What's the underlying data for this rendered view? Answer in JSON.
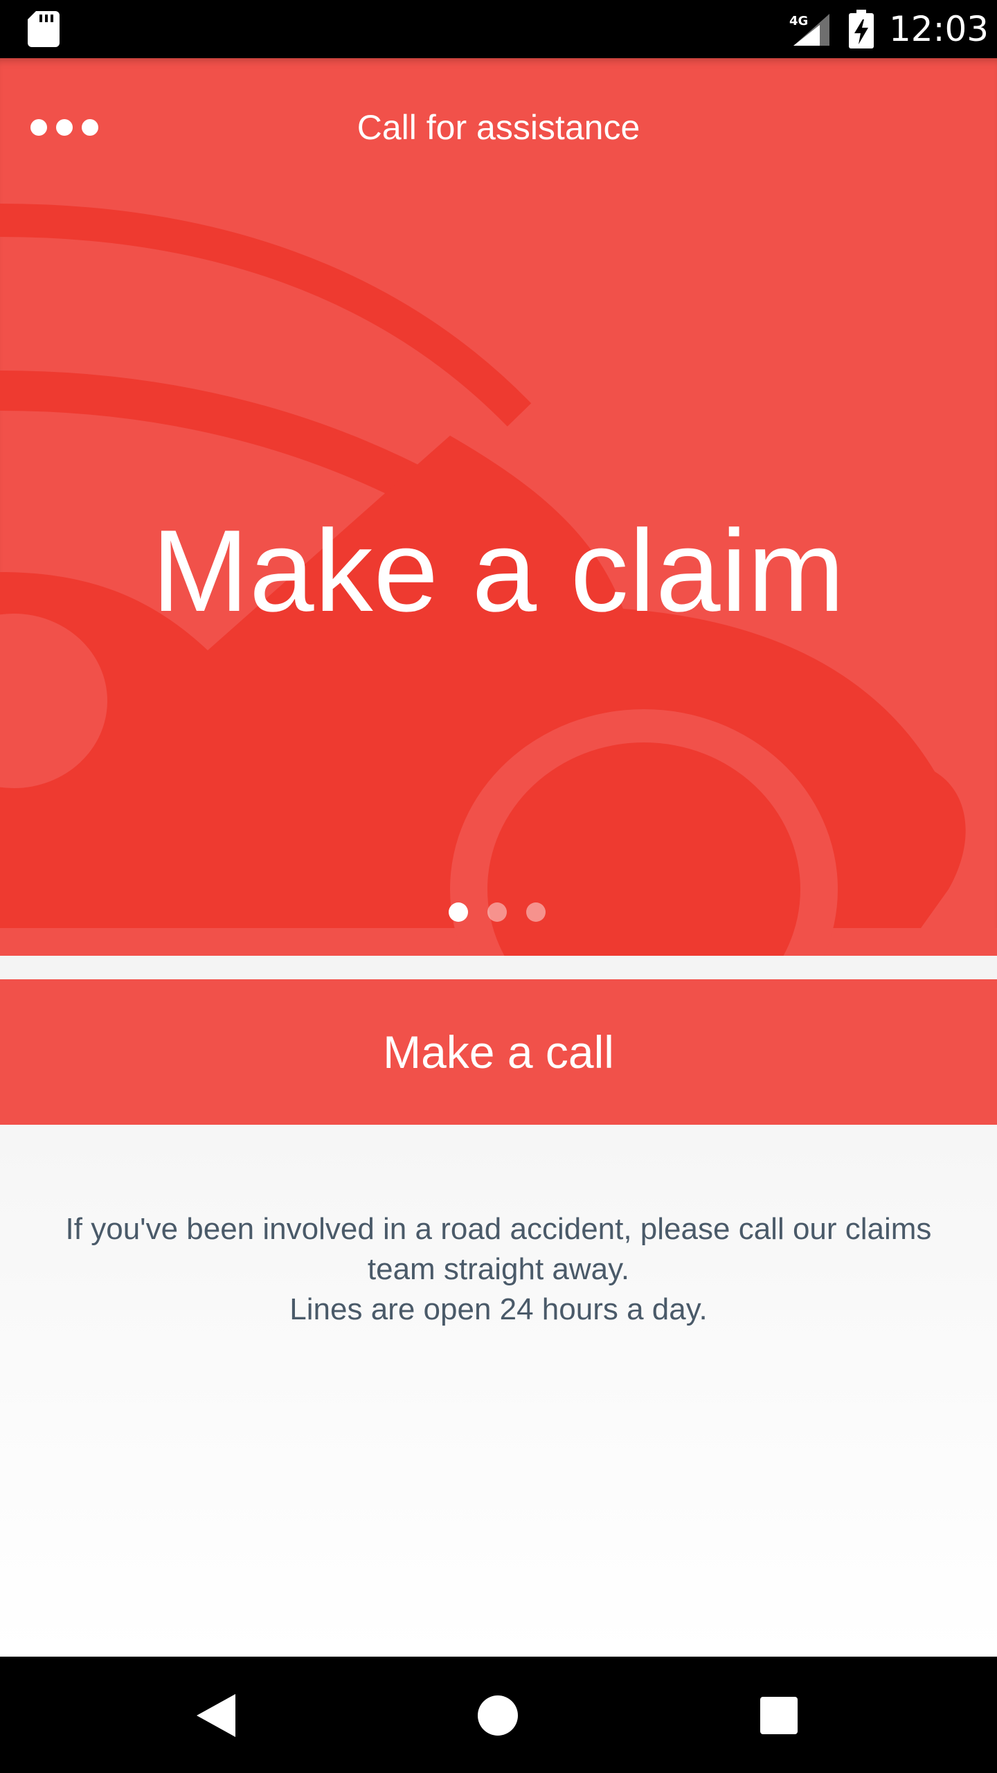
{
  "status_bar": {
    "time": "12:03",
    "network": "4G",
    "icons": [
      "sd-card-icon",
      "signal-icon",
      "battery-charging-icon"
    ]
  },
  "header": {
    "menu_icon": "more-horizontal-icon",
    "title": "Call for assistance"
  },
  "hero": {
    "title": "Make a claim",
    "pager": {
      "count": 3,
      "active_index": 0
    },
    "background_illustration": "car-icon"
  },
  "action": {
    "call_label": "Make a call"
  },
  "info": {
    "lines": [
      "If you've been involved in a road accident, please call our claims",
      "team straight away.",
      "Lines are open 24 hours a day."
    ]
  },
  "nav_bar": {
    "icons": [
      "back-icon",
      "home-icon",
      "recents-icon"
    ]
  },
  "colors": {
    "brand_red": "#f1514a",
    "illustration_red": "#ee3a30",
    "body_text": "#4a5a69",
    "background": "#f7f7f7"
  }
}
